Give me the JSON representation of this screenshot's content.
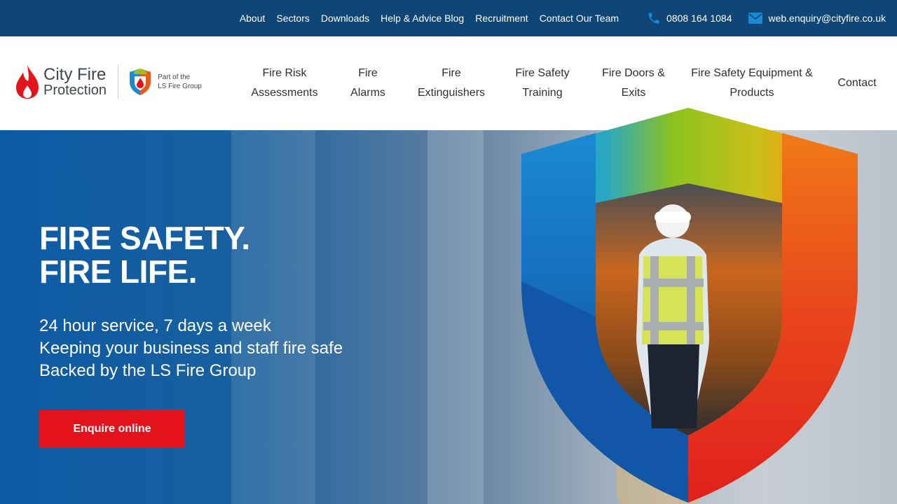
{
  "topbar": {
    "links": [
      "About",
      "Sectors",
      "Downloads",
      "Help & Advice Blog",
      "Recruitment",
      "Contact Our Team"
    ],
    "phone": "0808 164 1084",
    "email": "web.enquiry@cityfire.co.uk",
    "phone_icon": "phone-icon",
    "email_icon": "envelope-icon"
  },
  "brand": {
    "name_line1": "City Fire",
    "name_line2": "Protection",
    "part_of_line1": "Part of the",
    "part_of_line2": "LS Fire Group"
  },
  "nav": [
    {
      "line1": "Fire Risk",
      "line2": "Assessments"
    },
    {
      "line1": "Fire",
      "line2": "Alarms"
    },
    {
      "line1": "Fire",
      "line2": "Extinguishers"
    },
    {
      "line1": "Fire Safety",
      "line2": "Training"
    },
    {
      "line1": "Fire Doors &",
      "line2": "Exits"
    },
    {
      "line1": "Fire Safety Equipment &",
      "line2": "Products"
    },
    {
      "line1": "Contact",
      "line2": ""
    }
  ],
  "hero": {
    "headline_line1": "FIRE SAFETY.",
    "headline_line2": "FIRE LIFE.",
    "sub_line1": "24 hour service, 7 days a week",
    "sub_line2": "Keeping your business and staff fire safe",
    "sub_line3": "Backed by the LS Fire Group",
    "cta_label": "Enquire online"
  },
  "colors": {
    "topbar": "#0e4677",
    "accent_red": "#e3131b",
    "hero_blue": "#0d5aa5",
    "icon_blue": "#1a8ad4"
  }
}
